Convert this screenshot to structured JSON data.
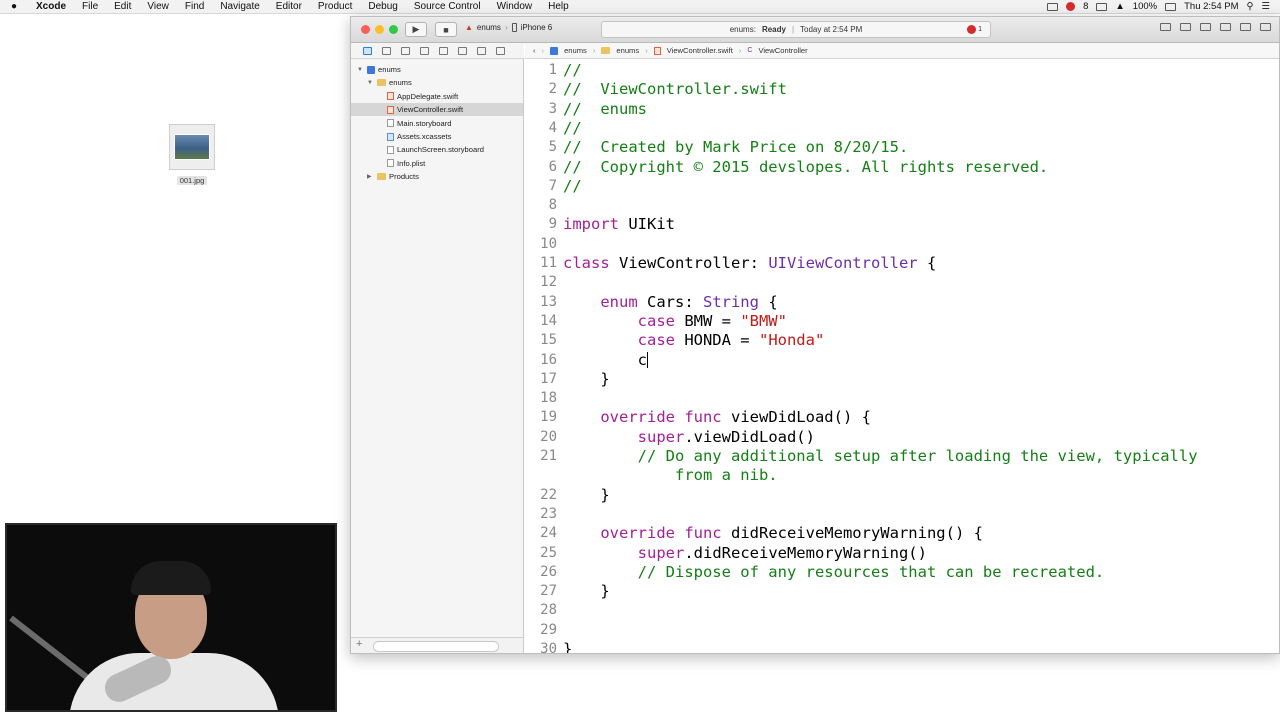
{
  "menubar": {
    "app_name": "Xcode",
    "items": [
      "File",
      "Edit",
      "View",
      "Find",
      "Navigate",
      "Editor",
      "Product",
      "Debug",
      "Source Control",
      "Window",
      "Help"
    ],
    "right": {
      "notifications": "8",
      "battery": "100%",
      "clock": "Thu 2:54 PM"
    }
  },
  "desktop": {
    "file_name": "001.jpg"
  },
  "toolbar": {
    "scheme": "enums",
    "device": "iPhone 6",
    "status_project": "enums:",
    "status_state": "Ready",
    "status_sep": "|",
    "status_time": "Today at 2:54 PM",
    "error_count": "1"
  },
  "navigator": {
    "items": [
      {
        "label": "enums",
        "kind": "project",
        "level": 0,
        "disclosure": "▼"
      },
      {
        "label": "enums",
        "kind": "folder",
        "level": 1,
        "disclosure": "▼"
      },
      {
        "label": "AppDelegate.swift",
        "kind": "swift",
        "level": 2,
        "disclosure": ""
      },
      {
        "label": "ViewController.swift",
        "kind": "swift",
        "level": 2,
        "disclosure": "",
        "selected": true
      },
      {
        "label": "Main.storyboard",
        "kind": "file",
        "level": 2,
        "disclosure": ""
      },
      {
        "label": "Assets.xcassets",
        "kind": "assets",
        "level": 2,
        "disclosure": ""
      },
      {
        "label": "LaunchScreen.storyboard",
        "kind": "file",
        "level": 2,
        "disclosure": ""
      },
      {
        "label": "Info.plist",
        "kind": "file",
        "level": 2,
        "disclosure": ""
      },
      {
        "label": "Products",
        "kind": "folder",
        "level": 1,
        "disclosure": "▶"
      }
    ]
  },
  "jumpbar": {
    "crumbs": [
      "enums",
      "enums",
      "ViewController.swift",
      "ViewController"
    ]
  },
  "editor": {
    "lines": [
      {
        "n": "1",
        "t": [
          [
            "cm",
            "//"
          ]
        ]
      },
      {
        "n": "2",
        "t": [
          [
            "cm",
            "//  ViewController.swift"
          ]
        ]
      },
      {
        "n": "3",
        "t": [
          [
            "cm",
            "//  enums"
          ]
        ]
      },
      {
        "n": "4",
        "t": [
          [
            "cm",
            "//"
          ]
        ]
      },
      {
        "n": "5",
        "t": [
          [
            "cm",
            "//  Created by Mark Price on 8/20/15."
          ]
        ]
      },
      {
        "n": "6",
        "t": [
          [
            "cm",
            "//  Copyright © 2015 devslopes. All rights reserved."
          ]
        ]
      },
      {
        "n": "7",
        "t": [
          [
            "cm",
            "//"
          ]
        ]
      },
      {
        "n": "8",
        "t": []
      },
      {
        "n": "9",
        "t": [
          [
            "kw",
            "import"
          ],
          [
            "",
            " UIKit"
          ]
        ]
      },
      {
        "n": "10",
        "t": []
      },
      {
        "n": "11",
        "t": [
          [
            "kw",
            "class"
          ],
          [
            "",
            " ViewController: "
          ],
          [
            "ty",
            "UIViewController"
          ],
          [
            "",
            " {"
          ]
        ]
      },
      {
        "n": "12",
        "t": []
      },
      {
        "n": "13",
        "t": [
          [
            "",
            "    "
          ],
          [
            "kw",
            "enum"
          ],
          [
            "",
            " Cars: "
          ],
          [
            "ty",
            "String"
          ],
          [
            "",
            " {"
          ]
        ]
      },
      {
        "n": "14",
        "t": [
          [
            "",
            "        "
          ],
          [
            "kw",
            "case"
          ],
          [
            "",
            " BMW = "
          ],
          [
            "str",
            "\"BMW\""
          ]
        ]
      },
      {
        "n": "15",
        "t": [
          [
            "",
            "        "
          ],
          [
            "kw",
            "case"
          ],
          [
            "",
            " HONDA = "
          ],
          [
            "str",
            "\"Honda\""
          ]
        ]
      },
      {
        "n": "16",
        "t": [
          [
            "",
            "        c"
          ]
        ],
        "caret": true
      },
      {
        "n": "17",
        "t": [
          [
            "",
            "    }"
          ]
        ]
      },
      {
        "n": "18",
        "t": []
      },
      {
        "n": "19",
        "t": [
          [
            "",
            "    "
          ],
          [
            "kw",
            "override func"
          ],
          [
            "",
            " viewDidLoad() {"
          ]
        ]
      },
      {
        "n": "20",
        "t": [
          [
            "",
            "        "
          ],
          [
            "kw",
            "super"
          ],
          [
            "",
            ".viewDidLoad()"
          ]
        ]
      },
      {
        "n": "21",
        "t": [
          [
            "",
            "        "
          ],
          [
            "cm",
            "// Do any additional setup after loading the view, typically"
          ]
        ]
      },
      {
        "n": "",
        "t": [
          [
            "",
            "            "
          ],
          [
            "cm",
            "from a nib."
          ]
        ]
      },
      {
        "n": "22",
        "t": [
          [
            "",
            "    }"
          ]
        ]
      },
      {
        "n": "23",
        "t": []
      },
      {
        "n": "24",
        "t": [
          [
            "",
            "    "
          ],
          [
            "kw",
            "override func"
          ],
          [
            "",
            " didReceiveMemoryWarning() {"
          ]
        ]
      },
      {
        "n": "25",
        "t": [
          [
            "",
            "        "
          ],
          [
            "kw",
            "super"
          ],
          [
            "",
            ".didReceiveMemoryWarning()"
          ]
        ]
      },
      {
        "n": "26",
        "t": [
          [
            "",
            "        "
          ],
          [
            "cm",
            "// Dispose of any resources that can be recreated."
          ]
        ]
      },
      {
        "n": "27",
        "t": [
          [
            "",
            "    }"
          ]
        ]
      },
      {
        "n": "28",
        "t": []
      },
      {
        "n": "29",
        "t": []
      },
      {
        "n": "30",
        "t": [
          [
            "",
            "}"
          ]
        ]
      }
    ]
  }
}
